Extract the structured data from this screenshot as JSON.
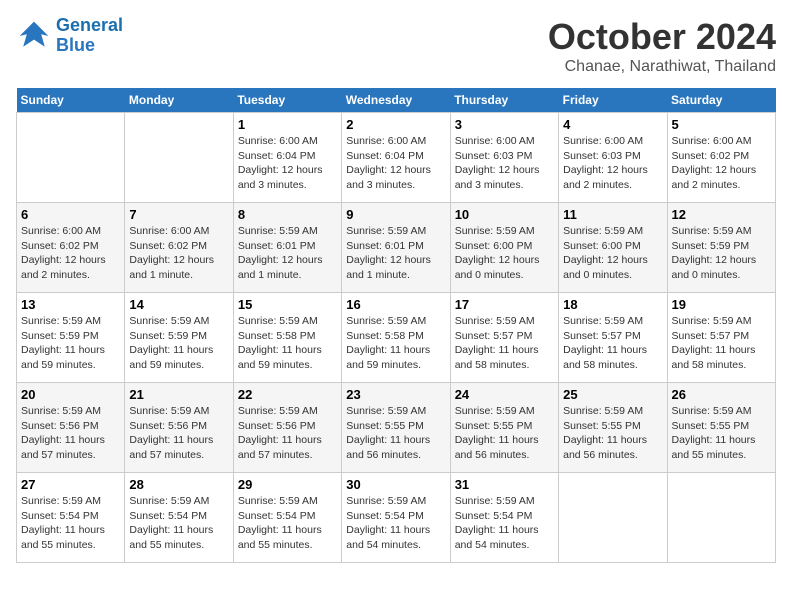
{
  "header": {
    "logo_line1": "General",
    "logo_line2": "Blue",
    "title": "October 2024",
    "subtitle": "Chanae, Narathiwat, Thailand"
  },
  "days_of_week": [
    "Sunday",
    "Monday",
    "Tuesday",
    "Wednesday",
    "Thursday",
    "Friday",
    "Saturday"
  ],
  "weeks": [
    [
      {
        "day": "",
        "info": ""
      },
      {
        "day": "",
        "info": ""
      },
      {
        "day": "1",
        "info": "Sunrise: 6:00 AM\nSunset: 6:04 PM\nDaylight: 12 hours and 3 minutes."
      },
      {
        "day": "2",
        "info": "Sunrise: 6:00 AM\nSunset: 6:04 PM\nDaylight: 12 hours and 3 minutes."
      },
      {
        "day": "3",
        "info": "Sunrise: 6:00 AM\nSunset: 6:03 PM\nDaylight: 12 hours and 3 minutes."
      },
      {
        "day": "4",
        "info": "Sunrise: 6:00 AM\nSunset: 6:03 PM\nDaylight: 12 hours and 2 minutes."
      },
      {
        "day": "5",
        "info": "Sunrise: 6:00 AM\nSunset: 6:02 PM\nDaylight: 12 hours and 2 minutes."
      }
    ],
    [
      {
        "day": "6",
        "info": "Sunrise: 6:00 AM\nSunset: 6:02 PM\nDaylight: 12 hours and 2 minutes."
      },
      {
        "day": "7",
        "info": "Sunrise: 6:00 AM\nSunset: 6:02 PM\nDaylight: 12 hours and 1 minute."
      },
      {
        "day": "8",
        "info": "Sunrise: 5:59 AM\nSunset: 6:01 PM\nDaylight: 12 hours and 1 minute."
      },
      {
        "day": "9",
        "info": "Sunrise: 5:59 AM\nSunset: 6:01 PM\nDaylight: 12 hours and 1 minute."
      },
      {
        "day": "10",
        "info": "Sunrise: 5:59 AM\nSunset: 6:00 PM\nDaylight: 12 hours and 0 minutes."
      },
      {
        "day": "11",
        "info": "Sunrise: 5:59 AM\nSunset: 6:00 PM\nDaylight: 12 hours and 0 minutes."
      },
      {
        "day": "12",
        "info": "Sunrise: 5:59 AM\nSunset: 5:59 PM\nDaylight: 12 hours and 0 minutes."
      }
    ],
    [
      {
        "day": "13",
        "info": "Sunrise: 5:59 AM\nSunset: 5:59 PM\nDaylight: 11 hours and 59 minutes."
      },
      {
        "day": "14",
        "info": "Sunrise: 5:59 AM\nSunset: 5:59 PM\nDaylight: 11 hours and 59 minutes."
      },
      {
        "day": "15",
        "info": "Sunrise: 5:59 AM\nSunset: 5:58 PM\nDaylight: 11 hours and 59 minutes."
      },
      {
        "day": "16",
        "info": "Sunrise: 5:59 AM\nSunset: 5:58 PM\nDaylight: 11 hours and 59 minutes."
      },
      {
        "day": "17",
        "info": "Sunrise: 5:59 AM\nSunset: 5:57 PM\nDaylight: 11 hours and 58 minutes."
      },
      {
        "day": "18",
        "info": "Sunrise: 5:59 AM\nSunset: 5:57 PM\nDaylight: 11 hours and 58 minutes."
      },
      {
        "day": "19",
        "info": "Sunrise: 5:59 AM\nSunset: 5:57 PM\nDaylight: 11 hours and 58 minutes."
      }
    ],
    [
      {
        "day": "20",
        "info": "Sunrise: 5:59 AM\nSunset: 5:56 PM\nDaylight: 11 hours and 57 minutes."
      },
      {
        "day": "21",
        "info": "Sunrise: 5:59 AM\nSunset: 5:56 PM\nDaylight: 11 hours and 57 minutes."
      },
      {
        "day": "22",
        "info": "Sunrise: 5:59 AM\nSunset: 5:56 PM\nDaylight: 11 hours and 57 minutes."
      },
      {
        "day": "23",
        "info": "Sunrise: 5:59 AM\nSunset: 5:55 PM\nDaylight: 11 hours and 56 minutes."
      },
      {
        "day": "24",
        "info": "Sunrise: 5:59 AM\nSunset: 5:55 PM\nDaylight: 11 hours and 56 minutes."
      },
      {
        "day": "25",
        "info": "Sunrise: 5:59 AM\nSunset: 5:55 PM\nDaylight: 11 hours and 56 minutes."
      },
      {
        "day": "26",
        "info": "Sunrise: 5:59 AM\nSunset: 5:55 PM\nDaylight: 11 hours and 55 minutes."
      }
    ],
    [
      {
        "day": "27",
        "info": "Sunrise: 5:59 AM\nSunset: 5:54 PM\nDaylight: 11 hours and 55 minutes."
      },
      {
        "day": "28",
        "info": "Sunrise: 5:59 AM\nSunset: 5:54 PM\nDaylight: 11 hours and 55 minutes."
      },
      {
        "day": "29",
        "info": "Sunrise: 5:59 AM\nSunset: 5:54 PM\nDaylight: 11 hours and 55 minutes."
      },
      {
        "day": "30",
        "info": "Sunrise: 5:59 AM\nSunset: 5:54 PM\nDaylight: 11 hours and 54 minutes."
      },
      {
        "day": "31",
        "info": "Sunrise: 5:59 AM\nSunset: 5:54 PM\nDaylight: 11 hours and 54 minutes."
      },
      {
        "day": "",
        "info": ""
      },
      {
        "day": "",
        "info": ""
      }
    ]
  ]
}
